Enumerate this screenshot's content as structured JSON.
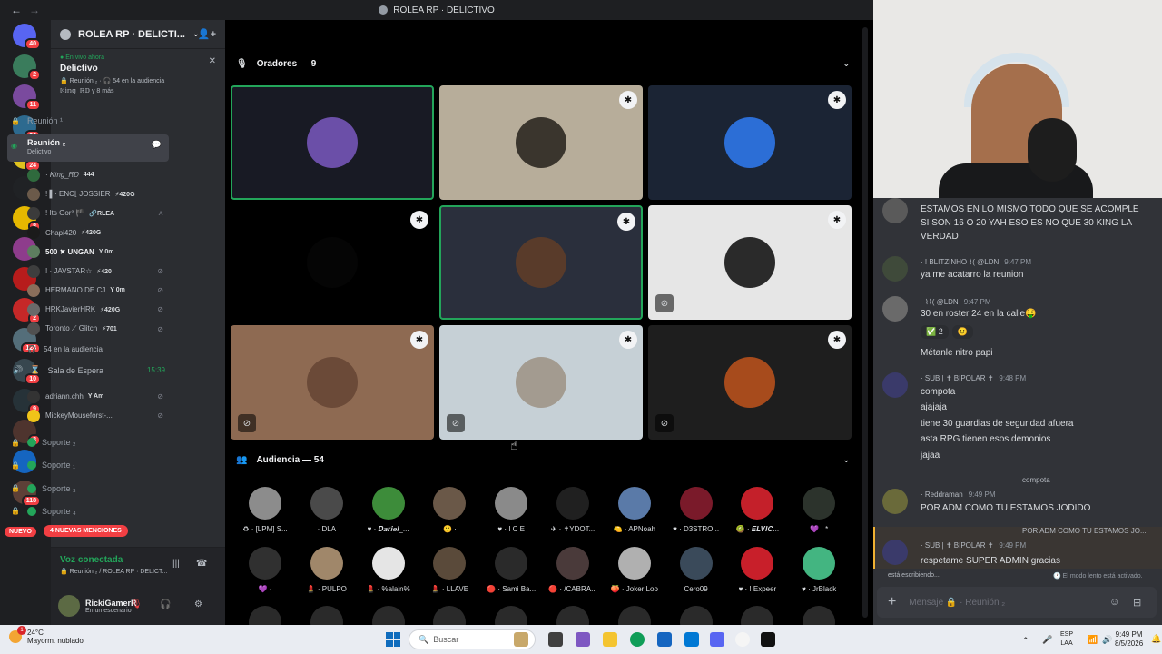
{
  "window": {
    "title": "ROLEA RP  ·  DELICTIVO",
    "back": "←",
    "forward": "→"
  },
  "servers": {
    "items": [
      {
        "badge": "40",
        "color": "#5865f2"
      },
      {
        "badge": "2",
        "color": "#3a7c5c"
      },
      {
        "badge": "11",
        "color": "#7a4a9e"
      },
      {
        "badge": "36",
        "color": "#2d6a8f"
      },
      {
        "badge": "24",
        "color": "#e0c31e"
      },
      {
        "badge": "",
        "color": "#202225"
      },
      {
        "badge": "8",
        "color": "#e6b800"
      },
      {
        "badge": "",
        "color": "#8e3c8c"
      },
      {
        "badge": "",
        "color": "#b71c1c"
      },
      {
        "badge": "2",
        "color": "#c62828"
      },
      {
        "badge": "124",
        "color": "#546e7a"
      },
      {
        "badge": "10",
        "color": "#37474f"
      },
      {
        "badge": "9",
        "color": "#263238"
      },
      {
        "badge": "3",
        "color": "#4e342e"
      },
      {
        "badge": "",
        "color": "#1565c0"
      },
      {
        "badge": "118",
        "color": "#5d4037"
      }
    ],
    "nuevo": "NUEVO"
  },
  "guild": {
    "name": "ROLEA RP  ·  DELICTI...",
    "chevron": "⌄",
    "add_icon": "👤+"
  },
  "live": {
    "status": "En vivo ahora",
    "title": "Delictivo",
    "info": "🔒 Reunión ₂  ·  🎧 54 en la audiencia",
    "users": "𝕂𝕚𝕟𝕘_ℝ𝔻 y 8 más",
    "close": "✕"
  },
  "channels": {
    "reunion_top": "Reunión ¹",
    "active": {
      "name": "Reunión ₂",
      "sub": "Delictivo"
    },
    "users": [
      {
        "name": "· 𝐾𝑖𝑛𝑔_𝑅𝐷",
        "tag": "444",
        "color": "#2f6a3d",
        "bold": false,
        "mic": ""
      },
      {
        "name": "! ▌· ENC⌊ JOSSIER",
        "tag": "⚡420G",
        "color": "#6b5a4a",
        "bold": false,
        "mic": ""
      },
      {
        "name": "! Its Gor² 🏴",
        "tag": "🔗RLEA",
        "color": "#3b3b3b",
        "bold": false,
        "mic": "⋏"
      },
      {
        "name": "Chapi420",
        "tag": "⚡420G",
        "color": "#1b1b1b",
        "bold": false,
        "mic": ""
      },
      {
        "name": "500 ✖ UNGAN",
        "tag": "Y 0m",
        "color": "#5d7d5f",
        "bold": true,
        "mic": ""
      },
      {
        "name": "! · JAVSTAR☆",
        "tag": "⚡420",
        "color": "#3e3e3e",
        "bold": false,
        "mic": "⊘"
      },
      {
        "name": "HERMANO DE CJ",
        "tag": "Y 0m",
        "color": "#8a6e5b",
        "bold": false,
        "mic": "⊘"
      },
      {
        "name": "HRKJavierHRK",
        "tag": "⚡420G",
        "color": "#6a6a6a",
        "bold": false,
        "mic": "⊘"
      },
      {
        "name": "Toronto ⟋ Glitch",
        "tag": "⚡701",
        "color": "#505050",
        "bold": false,
        "mic": "⊘"
      }
    ],
    "audience": "54 en la audiencia",
    "waiting": {
      "name": "Sala de Espera",
      "time": "15:39"
    },
    "waiting_users": [
      {
        "name": "adriann.chh",
        "tag": "Y Am",
        "color": "#333333"
      },
      {
        "name": "MickeyMouseforst-...",
        "tag": "",
        "color": "#f0c419"
      }
    ],
    "soporte": [
      "Soporte ₂",
      "Soporte ₁",
      "Soporte ₃",
      "Soporte ₄"
    ],
    "mentions": "4 NUEVAS MENCIONES"
  },
  "voice": {
    "status": "Voz conectada",
    "channel": "🔒 Reunión ₂ / ROLEA RP  ·  DELICT..."
  },
  "me": {
    "name": "RickiGamerR",
    "status": "En un escenario"
  },
  "stage": {
    "speakers_title": "Oradores — 9",
    "audience_title": "Audiencia — 54",
    "tiles": [
      {
        "bg": "#181a24",
        "avatar": "#6b4fa8",
        "speaking": true,
        "mod": false,
        "muted": false
      },
      {
        "bg": "#b7ad9a",
        "avatar": "#3a352d",
        "speaking": false,
        "mod": true,
        "muted": false
      },
      {
        "bg": "#1b2434",
        "avatar": "#2c6ed6",
        "speaking": false,
        "mod": true,
        "muted": false
      },
      {
        "bg": "#000000",
        "avatar": "#050505",
        "speaking": false,
        "mod": true,
        "muted": false
      },
      {
        "bg": "#2a2f3c",
        "avatar": "#593b2a",
        "speaking": true,
        "mod": true,
        "muted": false
      },
      {
        "bg": "#e6e6e6",
        "avatar": "#2a2a2a",
        "speaking": false,
        "mod": true,
        "muted": true
      },
      {
        "bg": "#8e6a52",
        "avatar": "#6b4a38",
        "speaking": false,
        "mod": true,
        "muted": true
      },
      {
        "bg": "#c6d0d6",
        "avatar": "#a39b90",
        "speaking": false,
        "mod": true,
        "muted": true
      },
      {
        "bg": "#1e1e1e",
        "avatar": "#a74b1c",
        "speaking": false,
        "mod": true,
        "muted": true
      }
    ],
    "audience": [
      {
        "label": "♻ · [LPM] S...",
        "color": "#8c8c8c"
      },
      {
        "label": "· DLA",
        "color": "#4a4a4a"
      },
      {
        "label": "♥ · 𝑫𝒂𝒓𝒊𝒆𝒍_...",
        "color": "#3d8c3a"
      },
      {
        "label": "🙂 ·",
        "color": "#6a5848"
      },
      {
        "label": "♥ · I C E",
        "color": "#8a8a8a"
      },
      {
        "label": "✈ · ✝YDOT...",
        "color": "#202020"
      },
      {
        "label": "🍋 · APNoah",
        "color": "#5a7aa8"
      },
      {
        "label": "♥ · D3STRO...",
        "color": "#7a1a2a"
      },
      {
        "label": "🥝 · 𝑬𝑳𝑽𝑰𝑪...",
        "color": "#c4202a"
      },
      {
        "label": "💜 · *",
        "color": "#2c332c"
      },
      {
        "label": "💜 ·",
        "color": "#303030"
      },
      {
        "label": "💄 · PULPO",
        "color": "#a0876a"
      },
      {
        "label": "💄 · %alain%",
        "color": "#e5e5e5"
      },
      {
        "label": "💄 · LLAVE",
        "color": "#5a4a3a"
      },
      {
        "label": "🔴 · Sami Ba...",
        "color": "#2a2a2a"
      },
      {
        "label": "🔴 · /CABRA...",
        "color": "#4a3a3a"
      },
      {
        "label": "🍑 · Joker Loo",
        "color": "#b0b0b0"
      },
      {
        "label": "Cero09",
        "color": "#3a4a5a"
      },
      {
        "label": "♥ · ! Expeer",
        "color": "#c81f2a"
      },
      {
        "label": "♥ · JrBlack",
        "color": "#43b581"
      }
    ]
  },
  "chat": {
    "messages": [
      {
        "author": "",
        "time": "",
        "lines": [
          "ESTAMOS EN LO MISMO TODO QUE SE ACOMPLE",
          "SI SON 16 O 20 YAH ESO ES NO QUE 30 KING LA",
          "VERDAD"
        ],
        "color": "#5a5a5a"
      },
      {
        "author": "· ! BLITZINHO ⌇( @LDN",
        "time": "9:47 PM",
        "lines": [
          "ya me acatarro la reunion"
        ],
        "color": "#3f4a3a"
      },
      {
        "author": "· ⌇⌇( @LDN",
        "time": "9:47 PM",
        "lines": [
          "30 en roster 24 en la calle🤑"
        ],
        "color": "#6a6a6a"
      },
      {
        "author": "",
        "time": "",
        "lines": [
          "Métanle nitro papi"
        ],
        "color": ""
      },
      {
        "author": "· SUB | ✝ BIPOLAR ✝",
        "time": "9:48 PM",
        "lines": [
          "compota",
          "ajajaja",
          "tiene 30 guardias de seguridad afuera",
          "asta RPG tienen esos demonios",
          "jajaa"
        ],
        "color": "#3a3a6a"
      },
      {
        "author": "· Reddraman",
        "time": "9:49 PM",
        "reply": "compota",
        "lines": [
          "POR ADM COMO TU ESTAMOS JODIDO"
        ],
        "color": "#6a6a3a"
      },
      {
        "author": "· SUB | ✝ BIPOLAR ✝",
        "time": "9:49 PM",
        "reply": "POR ADM COMO TU ESTAMOS JO...",
        "lines": [
          "respetame SUPER ADMIN gracias"
        ],
        "color": "#3a3a6a"
      }
    ],
    "reactions": [
      "✅ 2",
      "🙂"
    ],
    "typing": "está escribiendo...",
    "slowmode": "🕐 El modo lento está activado.",
    "placeholder": "Mensaje 🔒  ·  Reunión ₂"
  },
  "taskbar": {
    "weather_temp": "24°C",
    "weather_desc": "Mayorm. nublado",
    "weather_badge": "1",
    "search": "Buscar",
    "lang1": "ESP",
    "lang2": "LAA",
    "time": "9:49 PM",
    "date": "8/5/2026"
  }
}
